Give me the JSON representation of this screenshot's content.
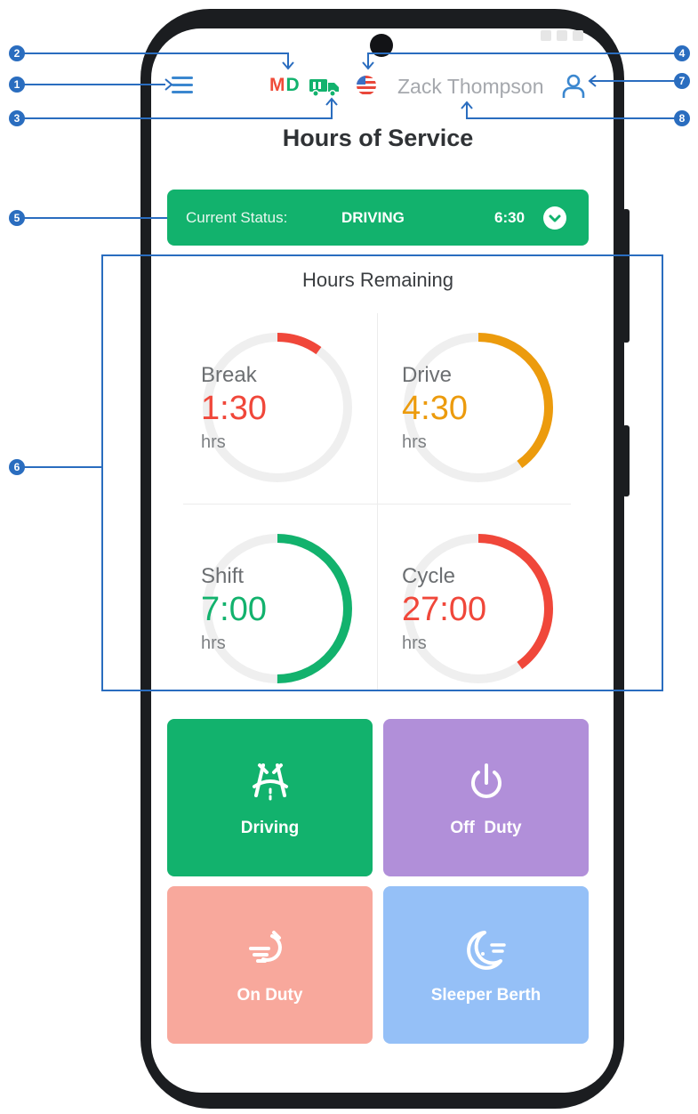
{
  "header": {
    "state_code": "MD",
    "user_name": "Zack Thompson",
    "page_title": "Hours of Service"
  },
  "status": {
    "label": "Current Status:",
    "value": "DRIVING",
    "time": "6:30"
  },
  "hours": {
    "title": "Hours Remaining",
    "dials": [
      {
        "name": "Break",
        "value": "1:30",
        "unit": "hrs",
        "color": "#f0473a",
        "fraction": 0.1
      },
      {
        "name": "Drive",
        "value": "4:30",
        "unit": "hrs",
        "color": "#ec9b0d",
        "fraction": 0.4
      },
      {
        "name": "Shift",
        "value": "7:00",
        "unit": "hrs",
        "color": "#12b26d",
        "fraction": 0.5
      },
      {
        "name": "Cycle",
        "value": "27:00",
        "unit": "hrs",
        "color": "#f0473a",
        "fraction": 0.4
      }
    ]
  },
  "actions": [
    {
      "label": "Driving",
      "color": "#12b26d",
      "icon": "road-icon"
    },
    {
      "label": "Off  Duty",
      "color": "#b18fd9",
      "icon": "power-icon"
    },
    {
      "label": "On Duty",
      "color": "#f8a89c",
      "icon": "fast-moving-icon"
    },
    {
      "label": "Sleeper Berth",
      "color": "#95c0f7",
      "icon": "moon-icon"
    }
  ],
  "callouts": [
    "1",
    "2",
    "3",
    "4",
    "5",
    "6",
    "7",
    "8"
  ],
  "colors": {
    "accent_blue": "#3b87cf",
    "callout_blue": "#2a6dbf",
    "state_red": "#ef4c3a",
    "state_green": "#12b26d",
    "driving_green": "#12b26d"
  }
}
